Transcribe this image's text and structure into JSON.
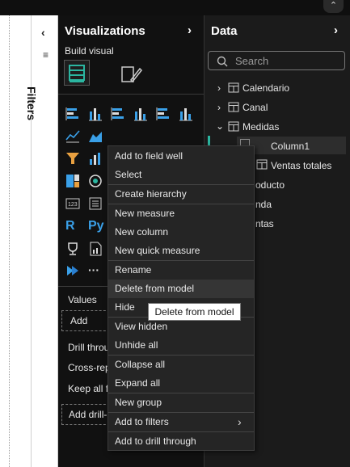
{
  "filters": {
    "label": "Filters"
  },
  "viz": {
    "title": "Visualizations",
    "build_visual": "Build visual",
    "values_label": "Values",
    "add_data_label": "Add data",
    "drill_through": "Drill throu",
    "cross_report": "Cross-rep",
    "keep_all": "Keep all f",
    "add_drill": "Add drill-"
  },
  "data": {
    "title": "Data",
    "search_placeholder": "Search",
    "tables": [
      "Calendario",
      "Canal",
      "Medidas"
    ],
    "column1": "Column1",
    "ventas_totales": "Ventas totales",
    "producto_partial": "oducto",
    "tienda_partial": "nda",
    "ventas_partial": "ntas"
  },
  "menu": {
    "items": [
      "Add to field well",
      "Select",
      "Create hierarchy",
      "New measure",
      "New column",
      "New quick measure",
      "Rename",
      "Delete from model",
      "Hide",
      "View hidden",
      "Unhide all",
      "Collapse all",
      "Expand all",
      "New group",
      "Add to filters",
      "Add to drill through"
    ]
  },
  "tooltip": {
    "text": "Delete from model"
  },
  "colors": {
    "accent_blue": "#3aa0e8",
    "teal": "#2bb5a0",
    "orange": "#e8a040"
  }
}
